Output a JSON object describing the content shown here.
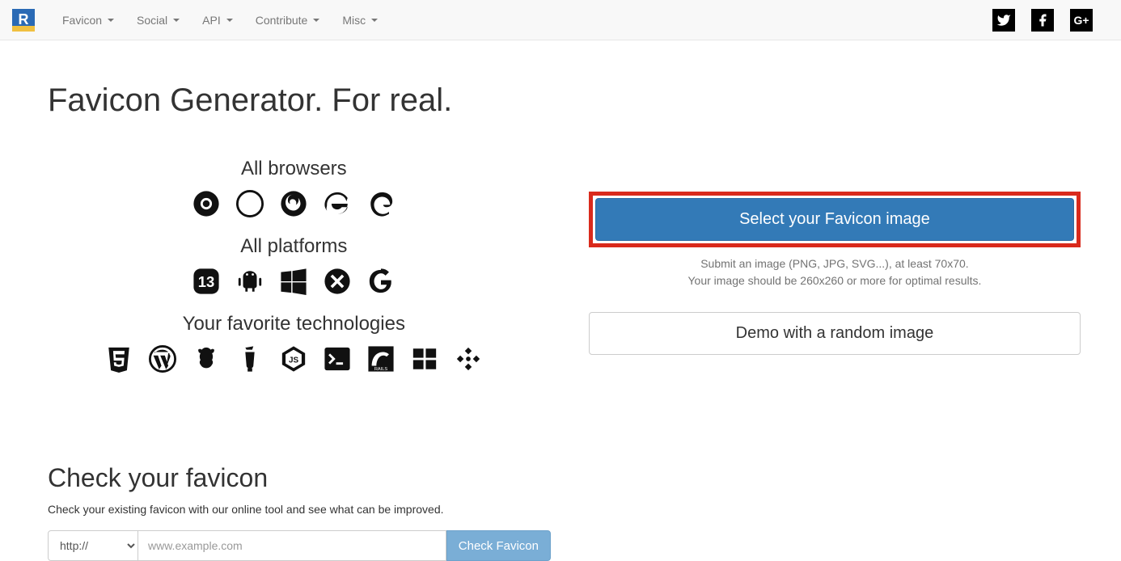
{
  "nav": {
    "items": [
      "Favicon",
      "Social",
      "API",
      "Contribute",
      "Misc"
    ]
  },
  "page": {
    "title": "Favicon Generator. For real.",
    "browsers_heading": "All browsers",
    "platforms_heading": "All platforms",
    "tech_heading": "Your favorite technologies",
    "select_button": "Select your Favicon image",
    "help_line1": "Submit an image (PNG, JPG, SVG...), at least 70x70.",
    "help_line2": "Your image should be 260x260 or more for optimal results.",
    "demo_button": "Demo with a random image",
    "check_heading": "Check your favicon",
    "check_desc": "Check your existing favicon with our online tool and see what can be improved.",
    "scheme": "http://",
    "url_placeholder": "www.example.com",
    "check_button": "Check Favicon"
  }
}
